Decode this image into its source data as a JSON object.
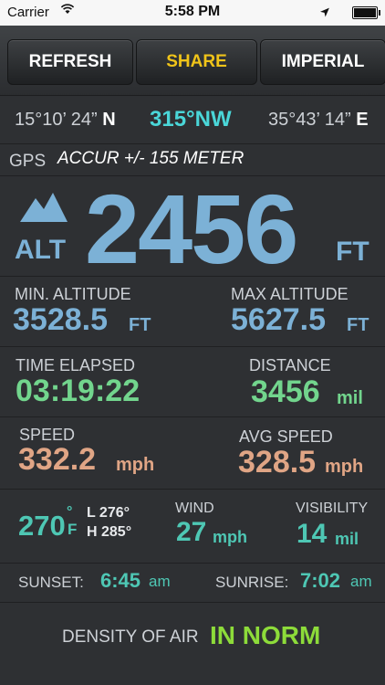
{
  "status": {
    "carrier": "Carrier",
    "time": "5:58 PM"
  },
  "toolbar": {
    "refresh": "REFRESH",
    "share": "SHARE",
    "units": "IMPERIAL"
  },
  "coords": {
    "lat": "15°10’ 24”",
    "lat_dir": "N",
    "heading": "315°NW",
    "lon": "35°43’ 14”",
    "lon_dir": "E"
  },
  "gps": {
    "label": "GPS",
    "accuracy": "ACCUR +/- 155 METER"
  },
  "altitude": {
    "label": "ALT",
    "value": "2456",
    "unit": "FT"
  },
  "altitude_range": {
    "min_label": "MIN. ALTITUDE",
    "min_value": "3528.5",
    "min_unit": "FT",
    "max_label": "MAX ALTITUDE",
    "max_value": "5627.5",
    "max_unit": "FT"
  },
  "time_distance": {
    "time_label": "TIME ELAPSED",
    "time_value": "03:19:22",
    "dist_label": "DISTANCE",
    "dist_value": "3456",
    "dist_unit": "mil"
  },
  "speed": {
    "speed_label": "SPEED",
    "speed_value": "332.2",
    "speed_unit": "mph",
    "avg_label": "AVG SPEED",
    "avg_value": "328.5",
    "avg_unit": "mph"
  },
  "weather": {
    "temp": "270",
    "deg": "°",
    "temp_unit": "F",
    "low": "L 276°",
    "high": "H 285°",
    "wind_label": "WIND",
    "wind_value": "27",
    "wind_unit": "mph",
    "vis_label": "VISIBILITY",
    "vis_value": "14",
    "vis_unit": "mil"
  },
  "sun": {
    "sunset_label": "SUNSET:",
    "sunset_value": "6:45",
    "sunset_unit": "am",
    "sunrise_label": "SUNRISE:",
    "sunrise_value": "7:02",
    "sunrise_unit": "am"
  },
  "air": {
    "label": "DENSITY OF AIR",
    "value": "IN NORM"
  }
}
